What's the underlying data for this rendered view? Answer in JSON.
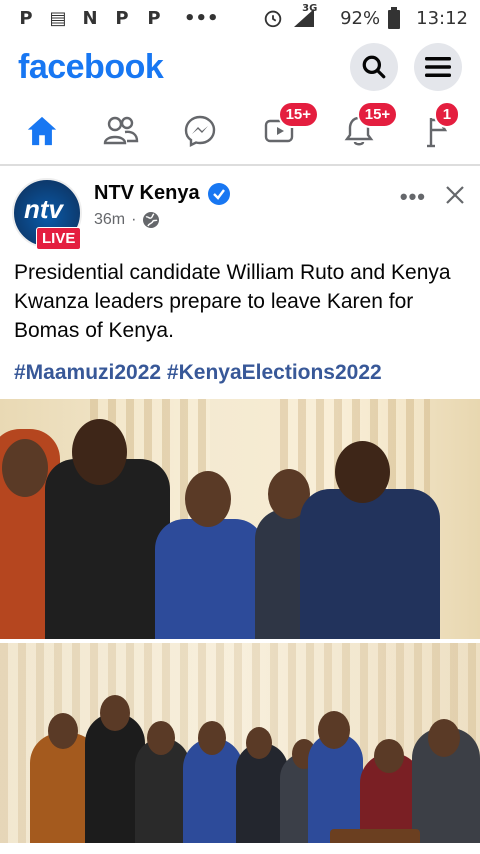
{
  "status_bar": {
    "left_icons": [
      "P",
      "▤",
      "N",
      "P",
      "P",
      "•••"
    ],
    "network": "3G",
    "battery": "92%",
    "time": "13:12"
  },
  "header": {
    "logo": "facebook"
  },
  "nav": {
    "video_badge": "15+",
    "notifications_badge": "15+",
    "menu_badge": "1"
  },
  "post": {
    "page_name": "NTV Kenya",
    "avatar_text": "ntv",
    "live_label": "LIVE",
    "time_ago": "36m",
    "separator": "·",
    "text": "Presidential candidate William Ruto and Kenya Kwanza leaders prepare to leave Karen for Bomas of Kenya.",
    "hashtags": "#Maamuzi2022 #KenyaElections2022"
  },
  "colors": {
    "brand": "#1877f2",
    "badge": "#e41e3f",
    "hashtag": "#385898"
  }
}
